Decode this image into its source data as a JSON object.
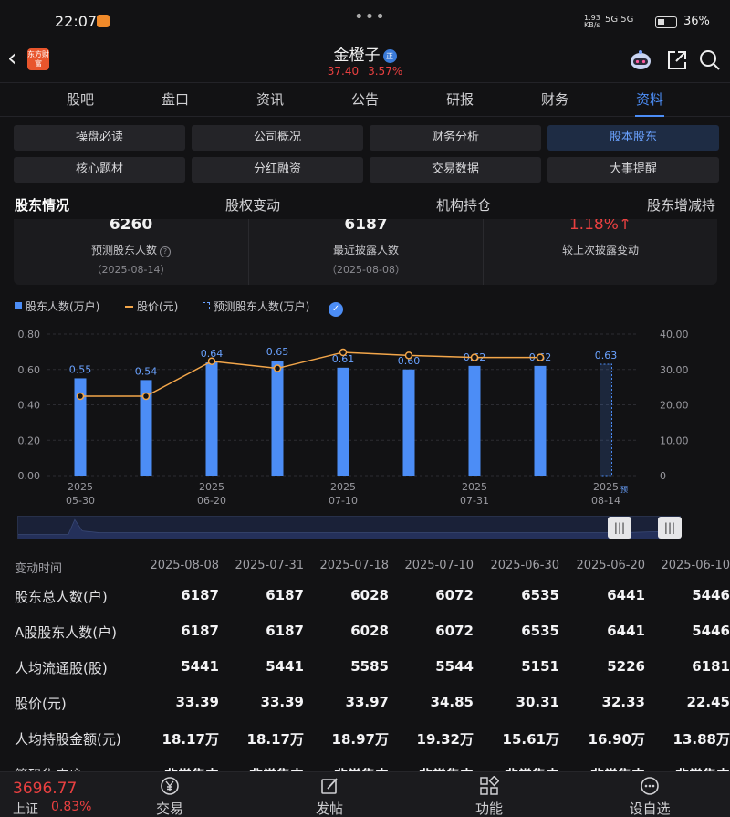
{
  "status_bar": {
    "time": "22:07",
    "net_speed_top": "1.93",
    "net_speed_bottom": "KB/s",
    "signal": "5G 5G",
    "battery": "36%"
  },
  "header": {
    "brand_logo": "东方财富",
    "stock_name": "金橙子",
    "badge": "正",
    "price": "37.40",
    "change_pct": "3.57%"
  },
  "main_tabs": [
    "股吧",
    "盘口",
    "资讯",
    "公告",
    "研报",
    "财务",
    "资料"
  ],
  "main_tab_active": "资料",
  "grid_buttons": [
    "操盘必读",
    "公司概况",
    "财务分析",
    "股本股东",
    "核心题材",
    "分红融资",
    "交易数据",
    "大事提醒"
  ],
  "grid_button_active": "股本股东",
  "sub_tabs": [
    "股东情况",
    "股权变动",
    "机构持仓",
    "股东增减持"
  ],
  "sub_tab_active": "股东情况",
  "stats": [
    {
      "value": "6260",
      "label": "预测股东人数",
      "date": "（2025-08-14）"
    },
    {
      "value": "6187",
      "label": "最近披露人数",
      "date": "（2025-08-08）"
    },
    {
      "value": "1.18%",
      "arrow": "↑",
      "label": "较上次披露变动",
      "date": ""
    }
  ],
  "legend": {
    "bars": "股东人数(万户)",
    "line": "股价(元)",
    "forecast": "预测股东人数(万户)",
    "check": "✓"
  },
  "chart_data": {
    "type": "bar",
    "categories": [
      "2025-05-30",
      "2025-06-10",
      "2025-06-20",
      "2025-06-30",
      "2025-07-10",
      "2025-07-18",
      "2025-07-31",
      "2025-08-08",
      "2025-08-14"
    ],
    "series": [
      {
        "name": "股东人数(万户)",
        "type": "bar",
        "axis": "left",
        "values": [
          0.55,
          0.54,
          0.64,
          0.65,
          0.61,
          0.6,
          0.62,
          0.62,
          0.63
        ],
        "labels": [
          "0.55",
          "0.54",
          "0.64",
          "0.65",
          "0.61",
          "0.60",
          "0.62",
          "0.62",
          "0.63"
        ],
        "forecast_index": 8
      },
      {
        "name": "股价(元)",
        "type": "line",
        "axis": "right",
        "values": [
          22.45,
          22.45,
          32.33,
          30.31,
          34.85,
          33.97,
          33.39,
          33.39
        ]
      }
    ],
    "x_tick_labels": [
      {
        "index": 0,
        "top": "2025",
        "bottom": "05-30"
      },
      {
        "index": 2,
        "top": "2025",
        "bottom": "06-20"
      },
      {
        "index": 4,
        "top": "2025",
        "bottom": "07-10"
      },
      {
        "index": 6,
        "top": "2025",
        "bottom": "07-31"
      },
      {
        "index": 8,
        "top": "2025",
        "bottom": "08-14",
        "suffix": "预"
      }
    ],
    "y_left": {
      "ylim": [
        0,
        0.8
      ],
      "ticks": [
        "0.00",
        "0.20",
        "0.40",
        "0.60",
        "0.80"
      ]
    },
    "y_right": {
      "ylim": [
        0,
        40
      ],
      "ticks": [
        "0",
        "10.00",
        "20.00",
        "30.00",
        "40.00"
      ]
    },
    "grid": true,
    "colors": {
      "bar": "#4c8df6",
      "line": "#f3a64a",
      "forecast": "#4c8df6"
    }
  },
  "table": {
    "header_label": "变动时间",
    "dates": [
      "2025-08-08",
      "2025-07-31",
      "2025-07-18",
      "2025-07-10",
      "2025-06-30",
      "2025-06-20",
      "2025-06-10"
    ],
    "rows": [
      {
        "label": "股东总人数(户)",
        "values": [
          "6187",
          "6187",
          "6028",
          "6072",
          "6535",
          "6441",
          "5446"
        ]
      },
      {
        "label": "A股股东人数(户)",
        "values": [
          "6187",
          "6187",
          "6028",
          "6072",
          "6535",
          "6441",
          "5446"
        ]
      },
      {
        "label": "人均流通股(股)",
        "values": [
          "5441",
          "5441",
          "5585",
          "5544",
          "5151",
          "5226",
          "6181"
        ]
      },
      {
        "label": "股价(元)",
        "values": [
          "33.39",
          "33.39",
          "33.97",
          "34.85",
          "30.31",
          "32.33",
          "22.45"
        ]
      },
      {
        "label": "人均持股金额(元)",
        "values": [
          "18.17万",
          "18.17万",
          "18.97万",
          "19.32万",
          "15.61万",
          "16.90万",
          "13.88万"
        ]
      },
      {
        "label": "筹码集中度",
        "values": [
          "非常集中",
          "非常集中",
          "非常集中",
          "非常集中",
          "非常集中",
          "非常集中",
          "非常集中"
        ]
      }
    ]
  },
  "bottom_bar": {
    "index_value": "3696.77",
    "index_name": "上证",
    "index_change": "0.83%",
    "nav": [
      {
        "label": "交易",
        "icon": "yen-icon"
      },
      {
        "label": "发帖",
        "icon": "edit-icon"
      },
      {
        "label": "功能",
        "icon": "grid-icon"
      },
      {
        "label": "设自选",
        "icon": "more-icon"
      }
    ]
  },
  "colors": {
    "accent": "#4c8df6",
    "up": "#e94040",
    "background": "#121214"
  }
}
